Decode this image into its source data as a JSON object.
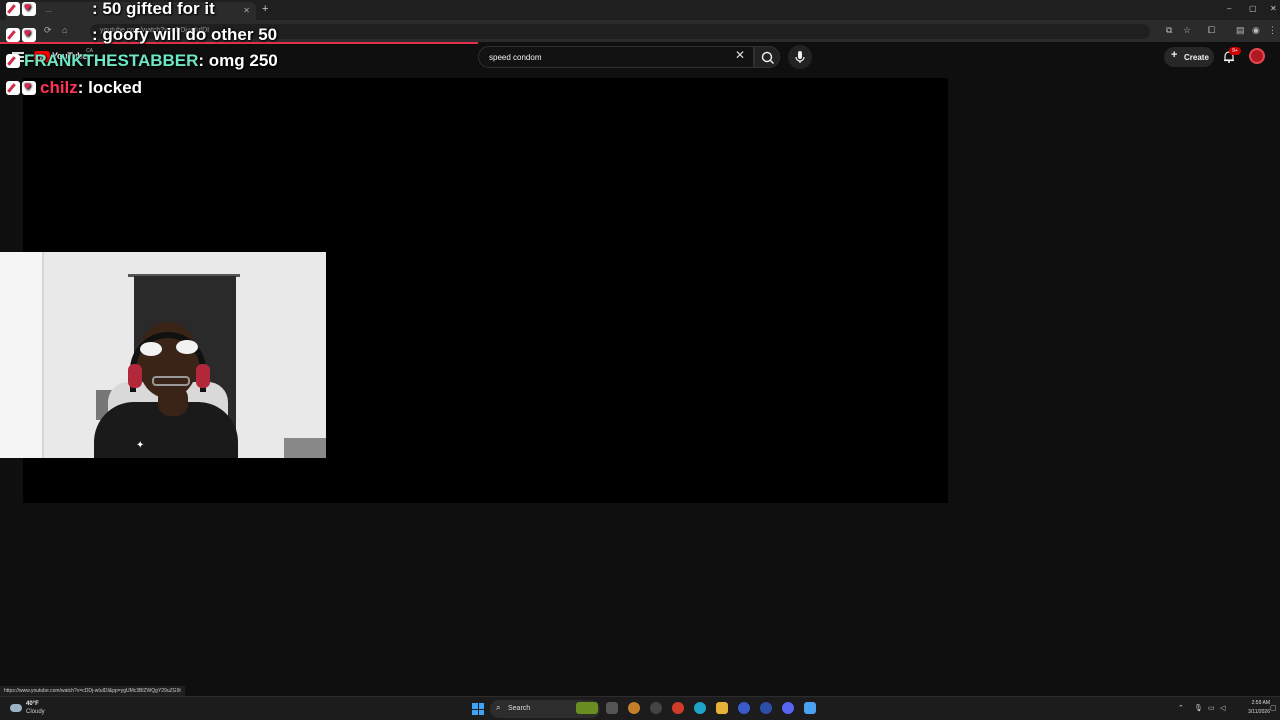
{
  "browser": {
    "tab_title": "...",
    "address": "youtube.com/watch?v=cDDj-wIuIDI",
    "window_controls": [
      "–",
      "▢",
      "✕"
    ]
  },
  "youtube": {
    "region": "CA",
    "logo_text": "YouTube",
    "search": {
      "value": "speed condom"
    },
    "create_label": "Create",
    "notification_count": "9+"
  },
  "chat": [
    {
      "user": "",
      "message": ": 50 gifted for it"
    },
    {
      "user": "",
      "message": ": goofy will do other 50"
    },
    {
      "user": "FRANKTHESTABBER",
      "message": ": omg 250"
    },
    {
      "user": "chilz",
      "message": ": locked"
    }
  ],
  "status_url": "https://www.youtube.com/watch?v=cDDj-wIuIDI&pp=ygUMc3BlZWQgY29uZG9t",
  "taskbar": {
    "weather_temp": "40°F",
    "weather_condition": "Cloudy",
    "search_label": "Search",
    "time": "2:59 AM",
    "date": "3/11/2026"
  },
  "colors": {
    "accent_red": "#e2304b",
    "chat_name_teal": "#6ee7c5",
    "chat_name_red": "#ff3355"
  }
}
